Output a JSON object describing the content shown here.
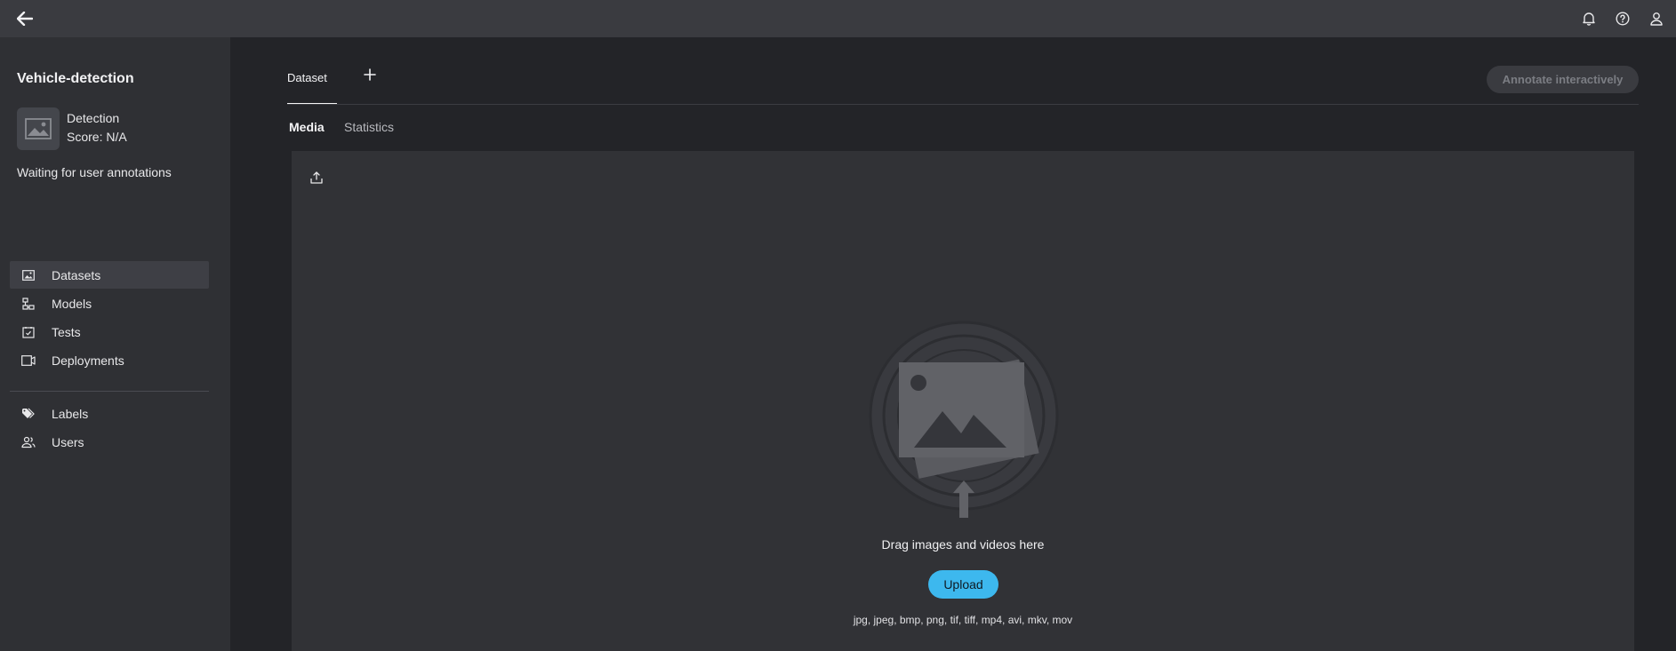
{
  "topbar": {
    "back_icon": "arrow-left-icon",
    "icons": [
      "bell-icon",
      "help-icon",
      "user-icon"
    ]
  },
  "project": {
    "name": "Vehicle-detection",
    "task": "Detection",
    "score": "Score: N/A",
    "status": "Waiting for user annotations"
  },
  "sidebar": {
    "items": [
      {
        "label": "Datasets",
        "icon": "image-icon",
        "active": true
      },
      {
        "label": "Models",
        "icon": "models-icon",
        "active": false
      },
      {
        "label": "Tests",
        "icon": "tests-icon",
        "active": false
      },
      {
        "label": "Deployments",
        "icon": "deployments-icon",
        "active": false
      }
    ],
    "items2": [
      {
        "label": "Labels",
        "icon": "labels-icon"
      },
      {
        "label": "Users",
        "icon": "users-icon"
      }
    ]
  },
  "tabs": {
    "dataset": "Dataset",
    "annotate": "Annotate interactively"
  },
  "subtabs": {
    "media": "Media",
    "statistics": "Statistics"
  },
  "dropzone": {
    "text": "Drag images and videos here",
    "upload": "Upload",
    "formats": "jpg, jpeg, bmp, png, tif, tiff, mp4, avi, mkv, mov"
  },
  "colors": {
    "accent": "#3db8ee",
    "topbar": "#3a3b40",
    "sidebar": "#2f3034",
    "background": "#232428"
  }
}
